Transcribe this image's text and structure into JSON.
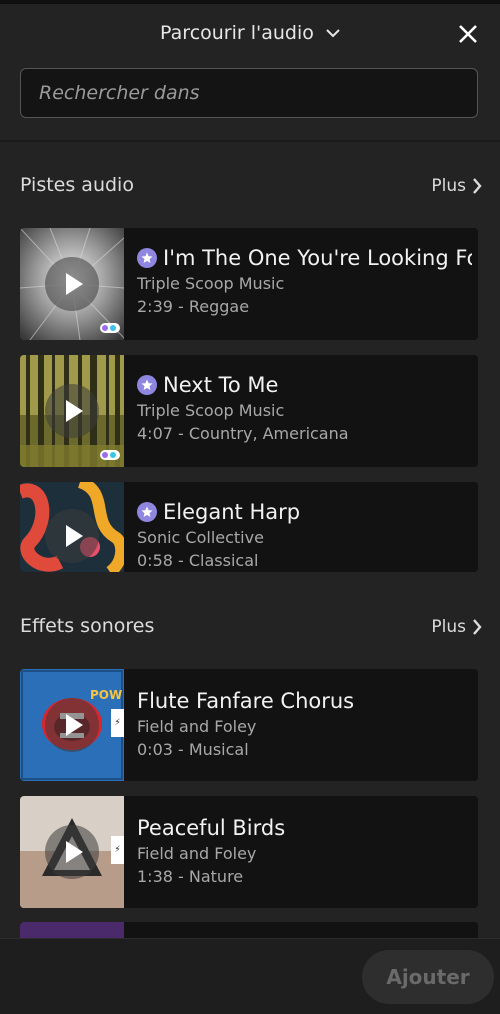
{
  "header": {
    "title": "Parcourir l'audio",
    "chevron_icon": "chevron-down-icon",
    "close_icon": "close-icon"
  },
  "search": {
    "placeholder": "Rechercher dans",
    "value": ""
  },
  "sections": {
    "tracks": {
      "title": "Pistes audio",
      "more": "Plus",
      "items": [
        {
          "title": "I'm The One You're Looking For",
          "artist": "Triple Scoop Music",
          "meta": "2:39 - Reggae",
          "premium": true
        },
        {
          "title": "Next To Me",
          "artist": "Triple Scoop Music",
          "meta": "4:07 - Country, Americana",
          "premium": true
        },
        {
          "title": "Elegant Harp",
          "artist": "Sonic Collective",
          "meta": "0:58 - Classical",
          "premium": true
        }
      ]
    },
    "effects": {
      "title": "Effets sonores",
      "more": "Plus",
      "items": [
        {
          "title": "Flute Fanfare Chorus",
          "artist": "Field and Foley",
          "meta": "0:03 - Musical"
        },
        {
          "title": "Peaceful Birds",
          "artist": "Field and Foley",
          "meta": "1:38 - Nature"
        }
      ]
    }
  },
  "footer": {
    "add_label": "Ajouter"
  },
  "colors": {
    "background": "#232323",
    "card": "#121212",
    "premium_star": "#8f86e0"
  }
}
